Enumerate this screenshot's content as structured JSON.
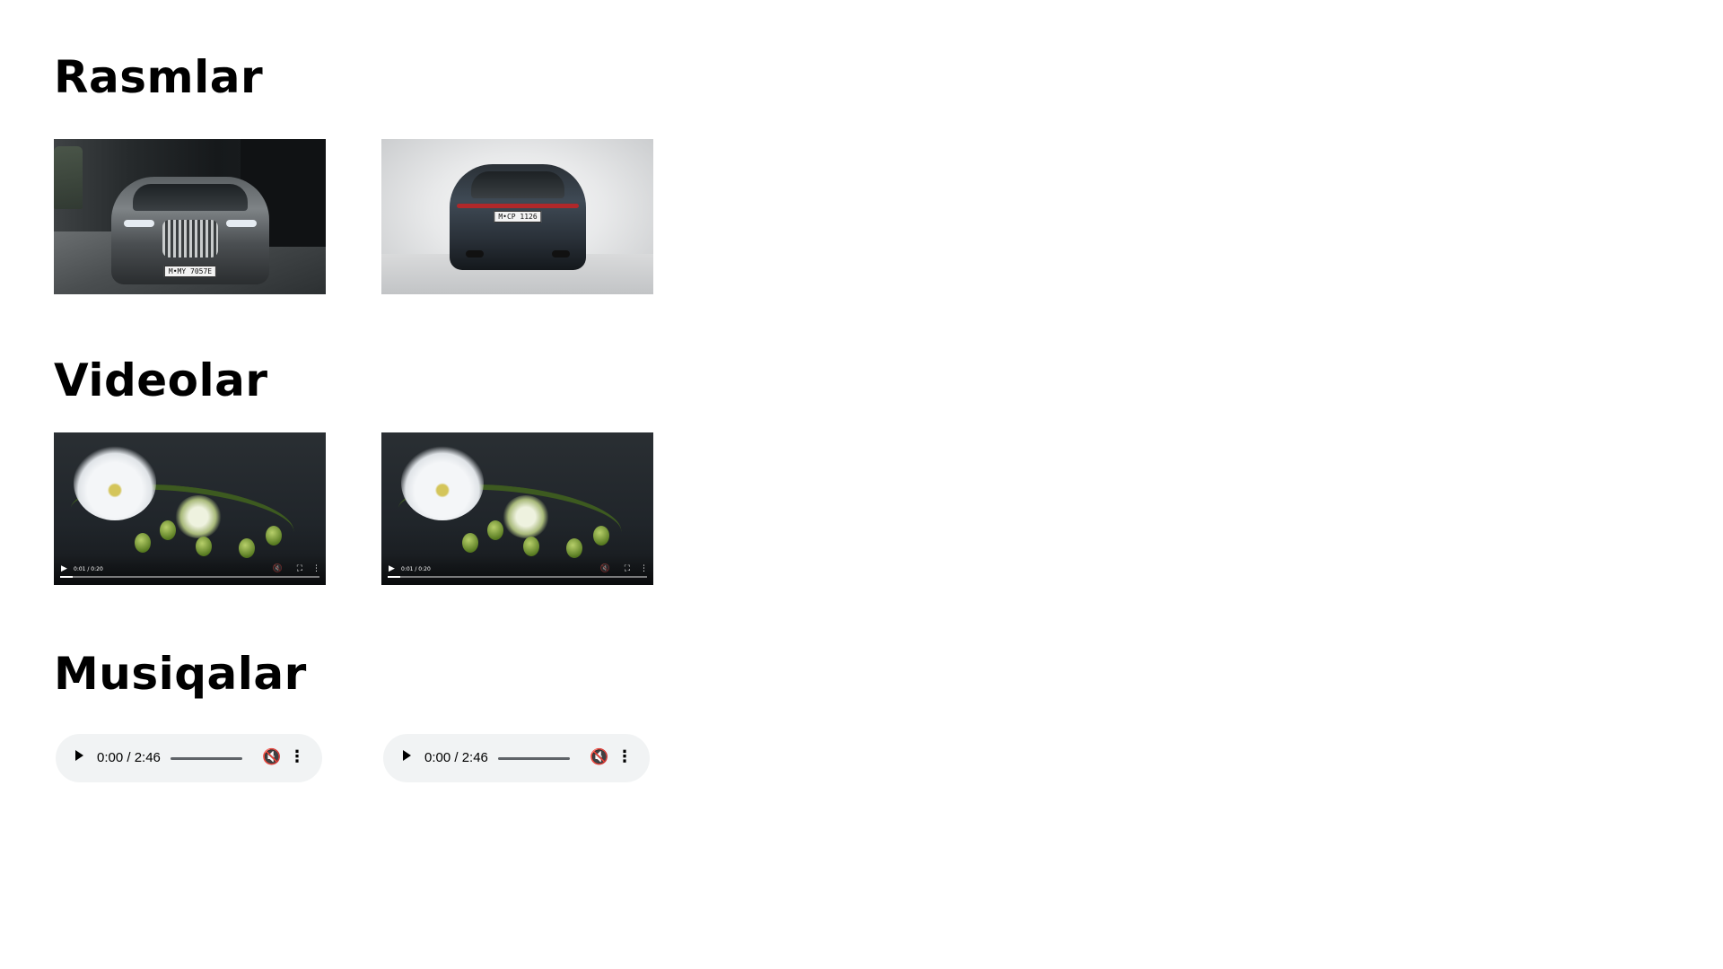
{
  "sections": {
    "images": {
      "title": "Rasmlar"
    },
    "videos": {
      "title": "Videolar"
    },
    "music": {
      "title": "Musiqalar"
    }
  },
  "images": [
    {
      "plate": "M•MY 7057E"
    },
    {
      "plate": "M•CP 1126"
    }
  ],
  "videos": [
    {
      "time": "0:01 / 0:20",
      "progress": 0.05
    },
    {
      "time": "0:01 / 0:20",
      "progress": 0.05
    }
  ],
  "audios": [
    {
      "time": "0:00 / 2:46",
      "muted": true
    },
    {
      "time": "0:00 / 2:46",
      "muted": true
    }
  ],
  "icons": {
    "play": "play-icon",
    "mute": "volume-mute-icon",
    "fullscreen": "fullscreen-icon",
    "more": "more-vertical-icon"
  },
  "colors": {
    "background": "#ffffff",
    "audio_bar": "#f1f3f4"
  }
}
